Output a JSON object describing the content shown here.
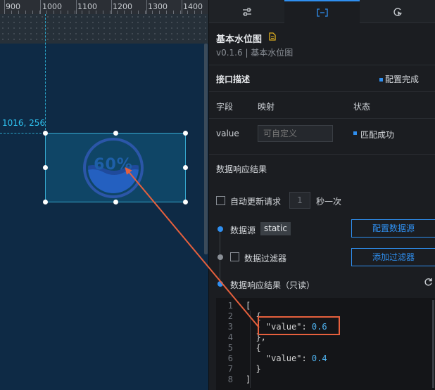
{
  "ruler": {
    "ticks": [
      "900",
      "1000",
      "1100",
      "1200",
      "1300",
      "1400"
    ]
  },
  "canvas": {
    "coord_readout": "1016, 256"
  },
  "widget": {
    "percent_text": "60%",
    "level": 0.6
  },
  "tabs": [
    {
      "name": "style",
      "icon": "sliders-icon"
    },
    {
      "name": "data",
      "icon": "bracket-icon",
      "active": true
    },
    {
      "name": "interaction",
      "icon": "refresh-click-icon"
    }
  ],
  "component": {
    "title": "基本水位图",
    "version": "v0.1.6 | 基本水位图"
  },
  "api": {
    "title": "接口描述",
    "status": "配置完成",
    "header": {
      "field": "字段",
      "map": "映射",
      "status": "状态"
    },
    "row": {
      "field": "value",
      "map_placeholder": "可自定义",
      "status": "匹配成功"
    }
  },
  "response": {
    "title": "数据响应结果",
    "auto_label": "自动更新请求",
    "interval_value": "1",
    "interval_unit": "秒一次",
    "datasource_label": "数据源",
    "datasource_badge": "static",
    "config_button": "配置数据源",
    "filter_label": "数据过滤器",
    "add_filter_button": "添加过滤器",
    "result_label": "数据响应结果（只读）"
  },
  "code": {
    "line_numbers": [
      "1",
      "2",
      "3",
      "4",
      "5",
      "6",
      "7",
      "8"
    ],
    "l1": "[",
    "l2": "  {",
    "l3_key": "    \"value\": ",
    "l3_val": "0.6",
    "l4": "  },",
    "l5": "  {",
    "l6_key": "    \"value\": ",
    "l6_val": "0.4",
    "l7": "  }",
    "l8": "]"
  },
  "colors": {
    "accent": "#2f8ff0",
    "annotation": "#e6603d",
    "canvas_bg": "#0e2a45",
    "panel_bg": "#1b1d21"
  }
}
